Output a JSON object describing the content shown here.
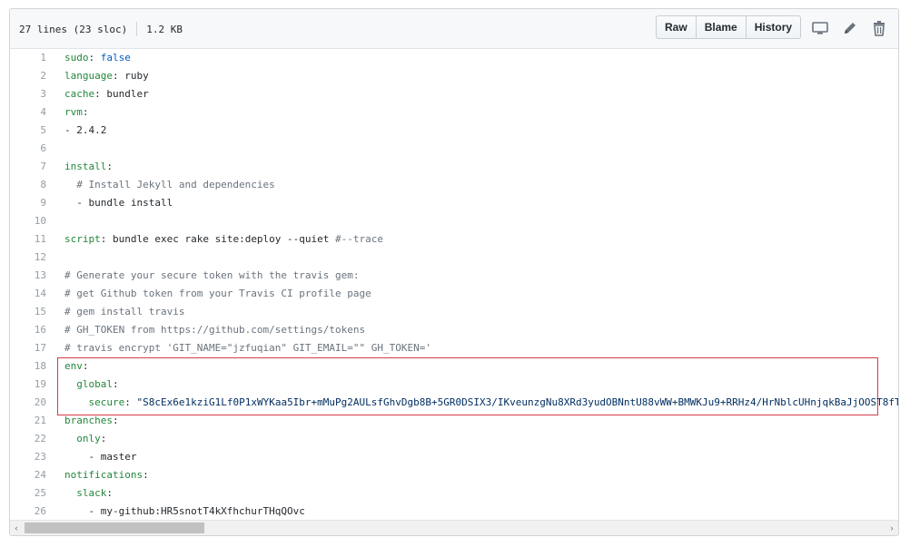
{
  "file_info": {
    "lines": "27 lines (23 sloc)",
    "size": "1.2 KB"
  },
  "toolbar": {
    "raw_label": "Raw",
    "blame_label": "Blame",
    "history_label": "History",
    "icons": [
      "desktop-icon",
      "pencil-icon",
      "trash-icon"
    ]
  },
  "code_lines": [
    {
      "num": "1",
      "parts": [
        {
          "t": "sudo",
          "c": "k"
        },
        {
          "t": ": ",
          "c": ""
        },
        {
          "t": "false",
          "c": "v"
        }
      ]
    },
    {
      "num": "2",
      "parts": [
        {
          "t": "language",
          "c": "k"
        },
        {
          "t": ": ruby",
          "c": ""
        }
      ]
    },
    {
      "num": "3",
      "parts": [
        {
          "t": "cache",
          "c": "k"
        },
        {
          "t": ": bundler",
          "c": ""
        }
      ]
    },
    {
      "num": "4",
      "parts": [
        {
          "t": "rvm",
          "c": "k"
        },
        {
          "t": ":",
          "c": ""
        }
      ]
    },
    {
      "num": "5",
      "parts": [
        {
          "t": "- 2.4.2",
          "c": ""
        }
      ]
    },
    {
      "num": "6",
      "parts": []
    },
    {
      "num": "7",
      "parts": [
        {
          "t": "install",
          "c": "k"
        },
        {
          "t": ":",
          "c": ""
        }
      ]
    },
    {
      "num": "8",
      "parts": [
        {
          "t": "  # Install Jekyll and dependencies",
          "c": "c"
        }
      ]
    },
    {
      "num": "9",
      "parts": [
        {
          "t": "  - bundle install",
          "c": ""
        }
      ]
    },
    {
      "num": "10",
      "parts": []
    },
    {
      "num": "11",
      "parts": [
        {
          "t": "script",
          "c": "k"
        },
        {
          "t": ": bundle exec rake site:deploy --quiet ",
          "c": ""
        },
        {
          "t": "#--trace",
          "c": "c"
        }
      ]
    },
    {
      "num": "12",
      "parts": []
    },
    {
      "num": "13",
      "parts": [
        {
          "t": "# Generate your secure token with the travis gem:",
          "c": "c"
        }
      ]
    },
    {
      "num": "14",
      "parts": [
        {
          "t": "# get Github token from your Travis CI profile page",
          "c": "c"
        }
      ]
    },
    {
      "num": "15",
      "parts": [
        {
          "t": "# gem install travis",
          "c": "c"
        }
      ]
    },
    {
      "num": "16",
      "parts": [
        {
          "t": "# GH_TOKEN from https://github.com/settings/tokens",
          "c": "c"
        }
      ]
    },
    {
      "num": "17",
      "parts": [
        {
          "t": "# travis encrypt 'GIT_NAME=\"jzfuqian\" GIT_EMAIL=\"\" GH_TOKEN='",
          "c": "c"
        }
      ]
    },
    {
      "num": "18",
      "parts": [
        {
          "t": "env",
          "c": "k"
        },
        {
          "t": ":",
          "c": ""
        }
      ]
    },
    {
      "num": "19",
      "parts": [
        {
          "t": "  ",
          "c": ""
        },
        {
          "t": "global",
          "c": "k"
        },
        {
          "t": ":",
          "c": ""
        }
      ]
    },
    {
      "num": "20",
      "parts": [
        {
          "t": "    ",
          "c": ""
        },
        {
          "t": "secure",
          "c": "k"
        },
        {
          "t": ": ",
          "c": ""
        },
        {
          "t": "\"S8cEx6e1kziG1Lf0P1xWYKaa5Ibr+mMuPg2AULsfGhvDgb8B+5GR0DSIX3/IKveunzgNu8XRd3yudOBNntU88vWW+BMWKJu9+RRHz4/HrNblcUHnjqkBaJjOOST8fT",
          "c": "s"
        }
      ]
    },
    {
      "num": "21",
      "parts": [
        {
          "t": "branches",
          "c": "k"
        },
        {
          "t": ":",
          "c": ""
        }
      ]
    },
    {
      "num": "22",
      "parts": [
        {
          "t": "  ",
          "c": ""
        },
        {
          "t": "only",
          "c": "k"
        },
        {
          "t": ":",
          "c": ""
        }
      ]
    },
    {
      "num": "23",
      "parts": [
        {
          "t": "    - master",
          "c": ""
        }
      ]
    },
    {
      "num": "24",
      "parts": [
        {
          "t": "notifications",
          "c": "k"
        },
        {
          "t": ":",
          "c": ""
        }
      ]
    },
    {
      "num": "25",
      "parts": [
        {
          "t": "  ",
          "c": ""
        },
        {
          "t": "slack",
          "c": "k"
        },
        {
          "t": ":",
          "c": ""
        }
      ]
    },
    {
      "num": "26",
      "parts": [
        {
          "t": "    - my-github:HR5snotT4kXfhchurTHqQOvc",
          "c": ""
        }
      ]
    }
  ],
  "scrollbar": {
    "left_arrow": "‹",
    "right_arrow": "›"
  },
  "colors": {
    "highlight_border": "#d73a49",
    "key": "#22863a",
    "comment": "#6a737d",
    "string": "#032f62"
  }
}
